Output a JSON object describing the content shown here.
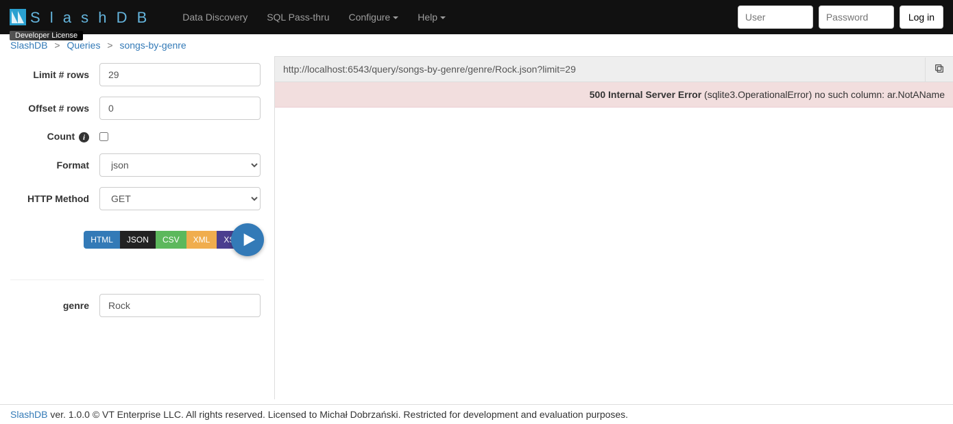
{
  "navbar": {
    "brand": "S l a s h D B",
    "license_badge": "Developer License",
    "links": {
      "data_discovery": "Data Discovery",
      "sql_passthru": "SQL Pass-thru",
      "configure": "Configure",
      "help": "Help"
    },
    "user_placeholder": "User",
    "password_placeholder": "Password",
    "login": "Log in"
  },
  "breadcrumb": {
    "root": "SlashDB",
    "queries": "Queries",
    "current": "songs-by-genre"
  },
  "form": {
    "limit_label": "Limit # rows",
    "limit_value": "29",
    "offset_label": "Offset # rows",
    "offset_value": "0",
    "count_label": "Count",
    "format_label": "Format",
    "format_value": "json",
    "http_method_label": "HTTP Method",
    "http_method_value": "GET",
    "genre_label": "genre",
    "genre_value": "Rock"
  },
  "format_buttons": {
    "html": "HTML",
    "json": "JSON",
    "csv": "CSV",
    "xml": "XML",
    "xsd": "XSD"
  },
  "content": {
    "url": "http://localhost:6543/query/songs-by-genre/genre/Rock.json?limit=29",
    "error_title": "500 Internal Server Error",
    "error_detail": " (sqlite3.OperationalError) no such column: ar.NotAName"
  },
  "footer": {
    "brand": "SlashDB",
    "text": " ver. 1.0.0 © VT Enterprise LLC. All rights reserved. Licensed to Michał Dobrzański. Restricted for development and evaluation purposes."
  }
}
